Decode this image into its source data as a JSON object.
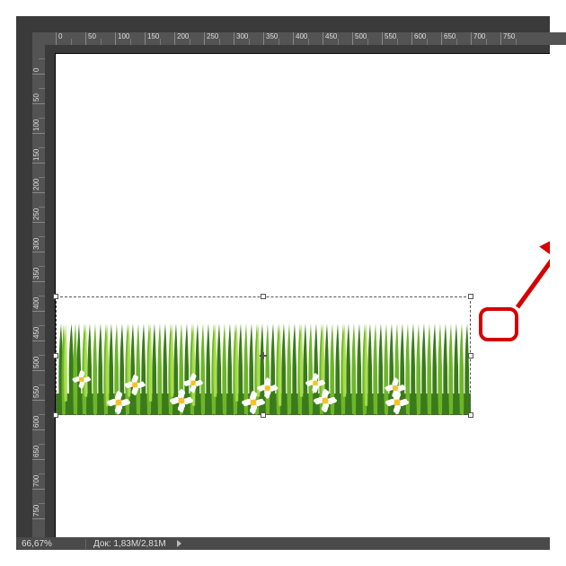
{
  "ruler_h": [
    "0",
    "50",
    "100",
    "150",
    "200",
    "250",
    "300",
    "350",
    "400",
    "450",
    "500",
    "550",
    "600",
    "650",
    "700",
    "750"
  ],
  "ruler_v": [
    "0",
    "50",
    "100",
    "150",
    "200",
    "250",
    "300",
    "350",
    "400",
    "450",
    "500",
    "550",
    "600",
    "650",
    "700",
    "750"
  ],
  "statusbar": {
    "zoom": "66,67%",
    "doc_label": "Док:",
    "doc_value": "1,83M/2,81M"
  },
  "colors": {
    "annotation": "#d40000",
    "grass_dark": "#3a7a1a",
    "grass_mid": "#6fb52a",
    "grass_light": "#a9e04a",
    "flower_center": "#f6c22a"
  }
}
